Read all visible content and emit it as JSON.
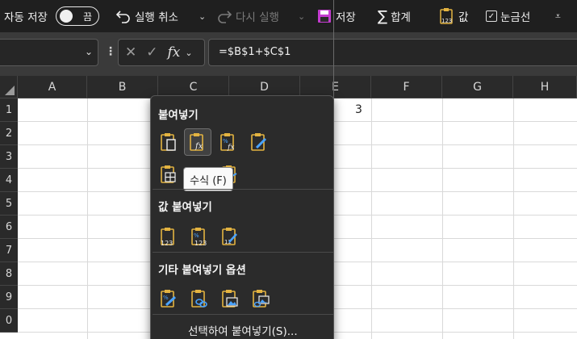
{
  "toolbar": {
    "autosave_label": "자동 저장",
    "autosave_state": "끔",
    "undo_label": "실행 취소",
    "redo_label": "다시 실행",
    "save_label": "저장",
    "sum_label": "합계",
    "value_label": "값",
    "gridlines_label": "눈금선",
    "gridlines_checked": true
  },
  "formula_bar": {
    "name_box": "",
    "formula": "=$B$1+$C$1"
  },
  "sheet": {
    "columns": [
      "A",
      "B",
      "C",
      "D",
      "E",
      "F",
      "G",
      "H"
    ],
    "rows": [
      "1",
      "2",
      "3",
      "4",
      "5",
      "6",
      "7",
      "8",
      "9",
      "0"
    ],
    "visible_values": {
      "E1": "3"
    }
  },
  "paste_menu": {
    "paste_title": "붙여넣기",
    "values_title": "값 붙여넣기",
    "other_title": "기타 붙여넣기 옵션",
    "tooltip": "수식 (F)",
    "paste_special": "선택하여 붙여넣기(S)..."
  },
  "colors": {
    "toolbar_bg": "#1f1f1f",
    "formula_bar_bg": "#3a3a3a",
    "menu_bg": "#2b2b2b",
    "icon_accent": "#e3b341",
    "icon_blue": "#4aa3ff",
    "save_icon": "#c43bd0"
  }
}
